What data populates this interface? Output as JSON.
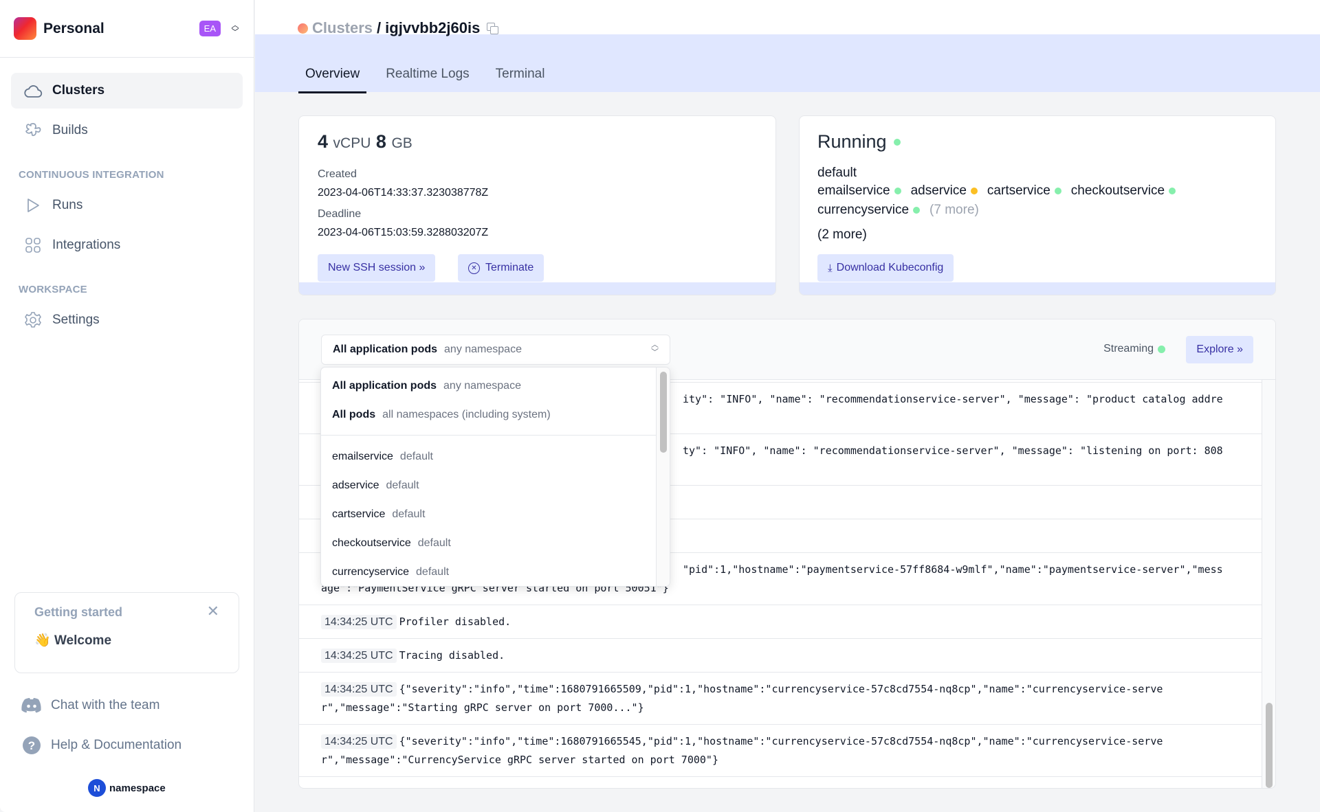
{
  "workspace": {
    "name": "Personal",
    "badge": "EA"
  },
  "sidebar": {
    "items": [
      {
        "label": "Clusters",
        "icon": "cloud-icon",
        "active": true
      },
      {
        "label": "Builds",
        "icon": "builds-icon"
      }
    ],
    "sections": [
      {
        "title": "CONTINUOUS INTEGRATION",
        "items": [
          {
            "label": "Runs",
            "icon": "play-icon"
          },
          {
            "label": "Integrations",
            "icon": "grid-icon"
          }
        ]
      },
      {
        "title": "WORKSPACE",
        "items": [
          {
            "label": "Settings",
            "icon": "gear-icon"
          }
        ]
      }
    ],
    "getting_started": {
      "title": "Getting started",
      "welcome_emoji": "👋",
      "welcome": "Welcome"
    },
    "footer": {
      "chat": "Chat with the team",
      "help": "Help & Documentation",
      "brand": "namespace",
      "brand_mark": "N"
    }
  },
  "breadcrumb": {
    "parent": "Clusters",
    "separator": "/",
    "current": "igjvvbb2j60is"
  },
  "tabs": [
    {
      "label": "Overview",
      "active": true
    },
    {
      "label": "Realtime Logs"
    },
    {
      "label": "Terminal"
    }
  ],
  "spec_card": {
    "cpu": "4",
    "cpu_unit": "vCPU",
    "mem": "8",
    "mem_unit": "GB",
    "created_label": "Created",
    "created": "2023-04-06T14:33:37.323038778Z",
    "deadline_label": "Deadline",
    "deadline": "2023-04-06T15:03:59.328803207Z",
    "ssh_button": "New SSH session »",
    "terminate_button": "Terminate"
  },
  "status_card": {
    "status": "Running",
    "namespace": "default",
    "services": [
      {
        "name": "emailservice",
        "state": "ok"
      },
      {
        "name": "adservice",
        "state": "pending"
      },
      {
        "name": "cartservice",
        "state": "ok"
      },
      {
        "name": "checkoutservice",
        "state": "ok"
      },
      {
        "name": "currencyservice",
        "state": "ok"
      }
    ],
    "services_more": "(7 more)",
    "namespaces_more": "(2 more)",
    "download_button": "Download Kubeconfig"
  },
  "colors": {
    "ok": "#86efac",
    "pending": "#fbbf24",
    "accent": "#e0e7ff",
    "accent_text": "#3730a3"
  },
  "logs": {
    "selector": {
      "label": "All application pods",
      "sub": "any namespace"
    },
    "streaming": "Streaming",
    "explore_button": "Explore »",
    "rows": [
      {
        "ts": "",
        "l1": "ity\": \"INFO\", \"name\": \"recommendationservice-server\", \"message\": \"product catalog addre",
        "l2": ""
      },
      {
        "ts": "",
        "l1": "ty\": \"INFO\", \"name\": \"recommendationservice-server\", \"message\": \"listening on port: 808",
        "l2": ""
      },
      {
        "ts": "",
        "l1": "",
        "l2": ""
      },
      {
        "ts": "",
        "l1": "",
        "l2": ""
      },
      {
        "ts": "",
        "l1": "\"pid\":1,\"hostname\":\"paymentservice-57ff8684-w9mlf\",\"name\":\"paymentservice-server\",\"mess",
        "l2": "age\":\"PaymentService gRPC server started on port 50051\"}"
      },
      {
        "ts": "14:34:25 UTC",
        "l1": "Profiler disabled.",
        "l2": ""
      },
      {
        "ts": "14:34:25 UTC",
        "l1": "Tracing disabled.",
        "l2": ""
      },
      {
        "ts": "14:34:25 UTC",
        "l1": "{\"severity\":\"info\",\"time\":1680791665509,\"pid\":1,\"hostname\":\"currencyservice-57c8cd7554-nq8cp\",\"name\":\"currencyservice-serve",
        "l2": "r\",\"message\":\"Starting gRPC server on port 7000...\"}"
      },
      {
        "ts": "14:34:25 UTC",
        "l1": "{\"severity\":\"info\",\"time\":1680791665545,\"pid\":1,\"hostname\":\"currencyservice-57c8cd7554-nq8cp\",\"name\":\"currencyservice-serve",
        "l2": "r\",\"message\":\"CurrencyService gRPC server started on port 7000\"}"
      }
    ]
  },
  "dropdown": {
    "options": [
      {
        "label": "All application pods",
        "sub": "any namespace",
        "bold": true
      },
      {
        "label": "All pods",
        "sub": "all namespaces (including system)",
        "bold": true
      },
      {
        "label": "emailservice",
        "sub": "default"
      },
      {
        "label": "adservice",
        "sub": "default"
      },
      {
        "label": "cartservice",
        "sub": "default"
      },
      {
        "label": "checkoutservice",
        "sub": "default"
      },
      {
        "label": "currencyservice",
        "sub": "default"
      }
    ]
  }
}
